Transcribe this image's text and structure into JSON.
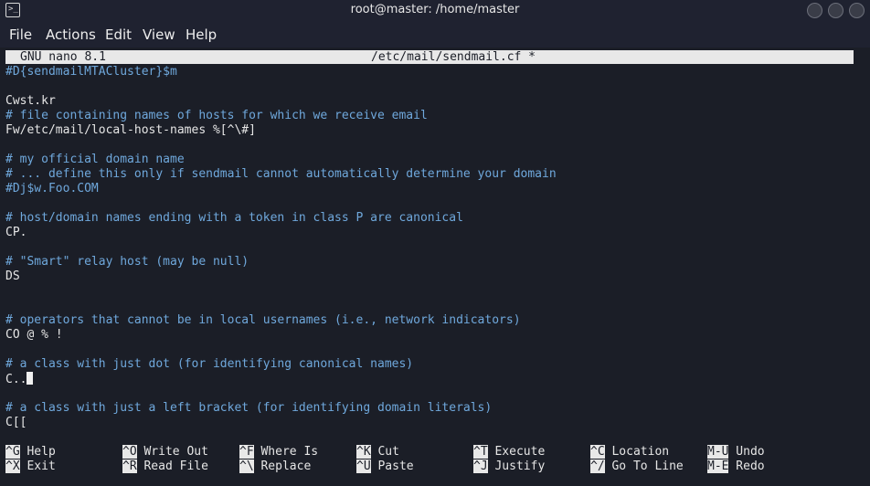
{
  "window": {
    "title": "root@master: /home/master",
    "icon": "terminal-icon"
  },
  "menu": [
    "File",
    "Actions",
    "Edit",
    "View",
    "Help"
  ],
  "nano": {
    "version": "GNU nano 8.1",
    "filename": "/etc/mail/sendmail.cf *"
  },
  "lines": [
    {
      "text": "#D{sendmailMTACluster}$m",
      "kind": "comment"
    },
    {
      "text": "",
      "kind": "plain"
    },
    {
      "text": "Cwst.kr",
      "kind": "plain"
    },
    {
      "text": "# file containing names of hosts for which we receive email",
      "kind": "comment"
    },
    {
      "text": "Fw/etc/mail/local-host-names %[^\\#]",
      "kind": "plain"
    },
    {
      "text": "",
      "kind": "plain"
    },
    {
      "text": "# my official domain name",
      "kind": "comment"
    },
    {
      "text": "# ... define this only if sendmail cannot automatically determine your domain",
      "kind": "comment"
    },
    {
      "text": "#Dj$w.Foo.COM",
      "kind": "comment"
    },
    {
      "text": "",
      "kind": "plain"
    },
    {
      "text": "# host/domain names ending with a token in class P are canonical",
      "kind": "comment"
    },
    {
      "text": "CP.",
      "kind": "plain"
    },
    {
      "text": "",
      "kind": "plain"
    },
    {
      "text": "# \"Smart\" relay host (may be null)",
      "kind": "comment"
    },
    {
      "text": "DS",
      "kind": "plain"
    },
    {
      "text": "",
      "kind": "plain"
    },
    {
      "text": "",
      "kind": "plain"
    },
    {
      "text": "# operators that cannot be in local usernames (i.e., network indicators)",
      "kind": "comment"
    },
    {
      "text": "CO @ % !",
      "kind": "plain"
    },
    {
      "text": "",
      "kind": "plain"
    },
    {
      "text": "# a class with just dot (for identifying canonical names)",
      "kind": "comment"
    },
    {
      "text": "C..",
      "kind": "plain"
    },
    {
      "text": "",
      "kind": "plain"
    },
    {
      "text": "# a class with just a left bracket (for identifying domain literals)",
      "kind": "comment"
    },
    {
      "text": "C[[",
      "kind": "plain"
    }
  ],
  "shortcuts": [
    {
      "key": "^G",
      "label": "Help"
    },
    {
      "key": "^O",
      "label": "Write Out"
    },
    {
      "key": "^F",
      "label": "Where Is"
    },
    {
      "key": "^K",
      "label": "Cut"
    },
    {
      "key": "^T",
      "label": "Execute"
    },
    {
      "key": "^C",
      "label": "Location"
    },
    {
      "key": "M-U",
      "label": "Undo"
    },
    {
      "key": "^X",
      "label": "Exit"
    },
    {
      "key": "^R",
      "label": "Read File"
    },
    {
      "key": "^\\",
      "label": "Replace"
    },
    {
      "key": "^U",
      "label": "Paste"
    },
    {
      "key": "^J",
      "label": "Justify"
    },
    {
      "key": "^/",
      "label": "Go To Line"
    },
    {
      "key": "M-E",
      "label": "Redo"
    }
  ]
}
